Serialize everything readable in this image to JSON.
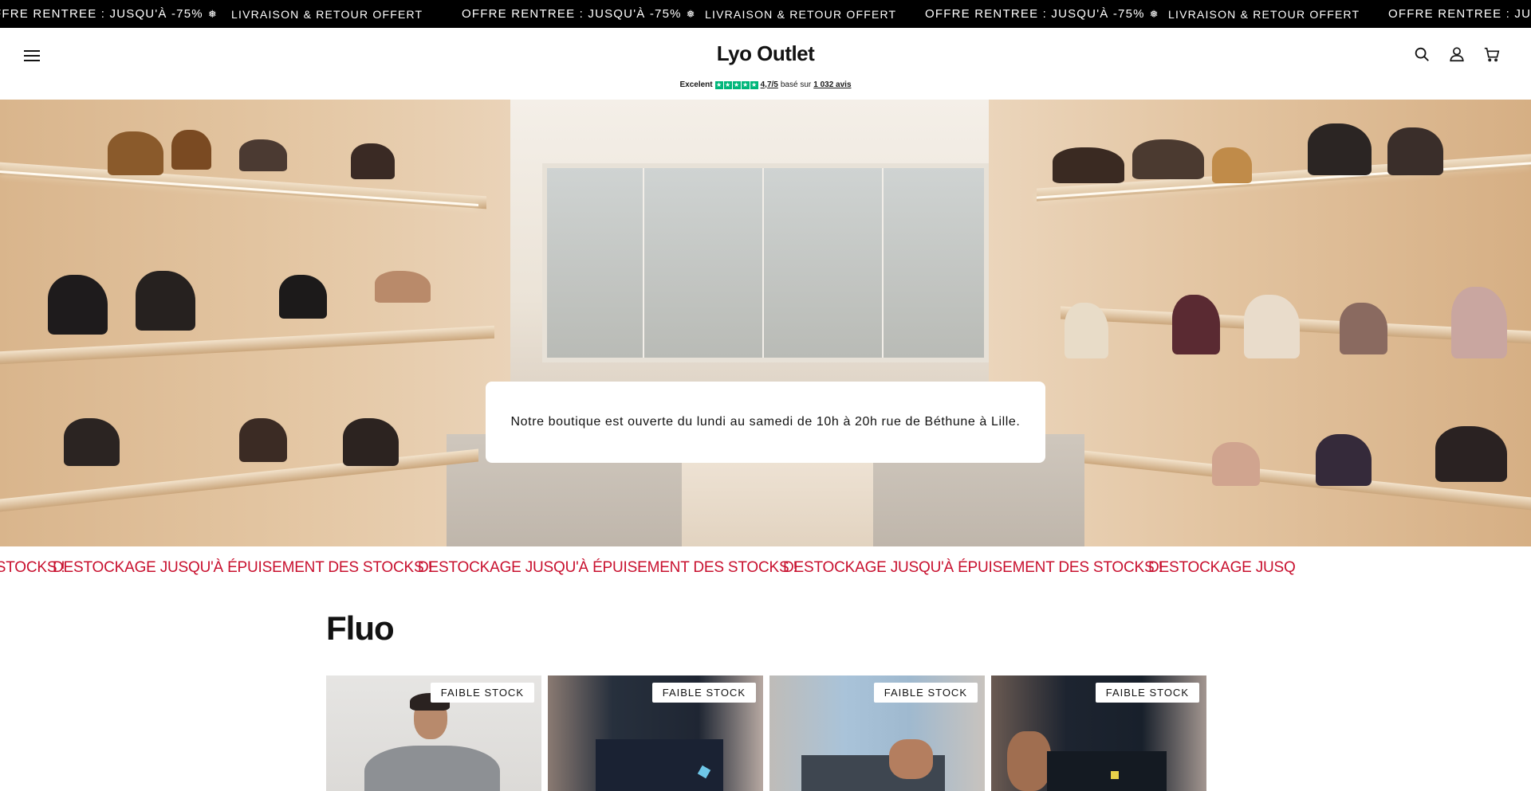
{
  "announcement": {
    "items": [
      {
        "text": "FFRE RENTREE : JUSQU'À -75%",
        "icon": "snowflake-icon",
        "kind": "offer"
      },
      {
        "text": "LIVRAISON & RETOUR OFFERT",
        "kind": "ship"
      },
      {
        "text": "OFFRE RENTREE : JUSQU'À -75%",
        "icon": "snowflake-icon",
        "kind": "offer"
      },
      {
        "text": "LIVRAISON & RETOUR OFFERT",
        "kind": "ship"
      },
      {
        "text": "OFFRE RENTREE : JUSQU'À -75%",
        "icon": "snowflake-icon",
        "kind": "offer"
      },
      {
        "text": "LIVRAISON & RETOUR OFFERT",
        "kind": "ship"
      },
      {
        "text": "OFFRE RENTREE : JUSQ",
        "kind": "offer"
      }
    ],
    "snow_glyph": "❅"
  },
  "header": {
    "logo": "Lyo Outlet",
    "icons": [
      "menu-icon",
      "search-icon",
      "account-icon",
      "cart-icon"
    ]
  },
  "trustpilot": {
    "label": "Excelent",
    "score": "4,7/5",
    "based_on": "basé sur",
    "reviews": "1 032 avis",
    "star_color": "#00b67a"
  },
  "hero": {
    "message": "Notre boutique est ouverte du lundi au samedi de 10h à 20h rue de Béthune à Lille."
  },
  "marquee": {
    "items": [
      "CKAGE JUSQU'À ÉPUISEMENT DES STOCKS !",
      "DESTOCKAGE JUSQU'À ÉPUISEMENT DES STOCKS !",
      "DESTOCKAGE JUSQU'À ÉPUISEMENT DES STOCKS !",
      "DESTOCKAGE JUSQU'À ÉPUISEMENT DES STOCKS !",
      "DESTOCKAGE JUSQ"
    ],
    "color": "#c8102e"
  },
  "collection": {
    "title": "Fluo",
    "products": [
      {
        "badge": "FAIBLE STOCK"
      },
      {
        "badge": "FAIBLE STOCK"
      },
      {
        "badge": "FAIBLE STOCK"
      },
      {
        "badge": "FAIBLE STOCK"
      }
    ]
  }
}
